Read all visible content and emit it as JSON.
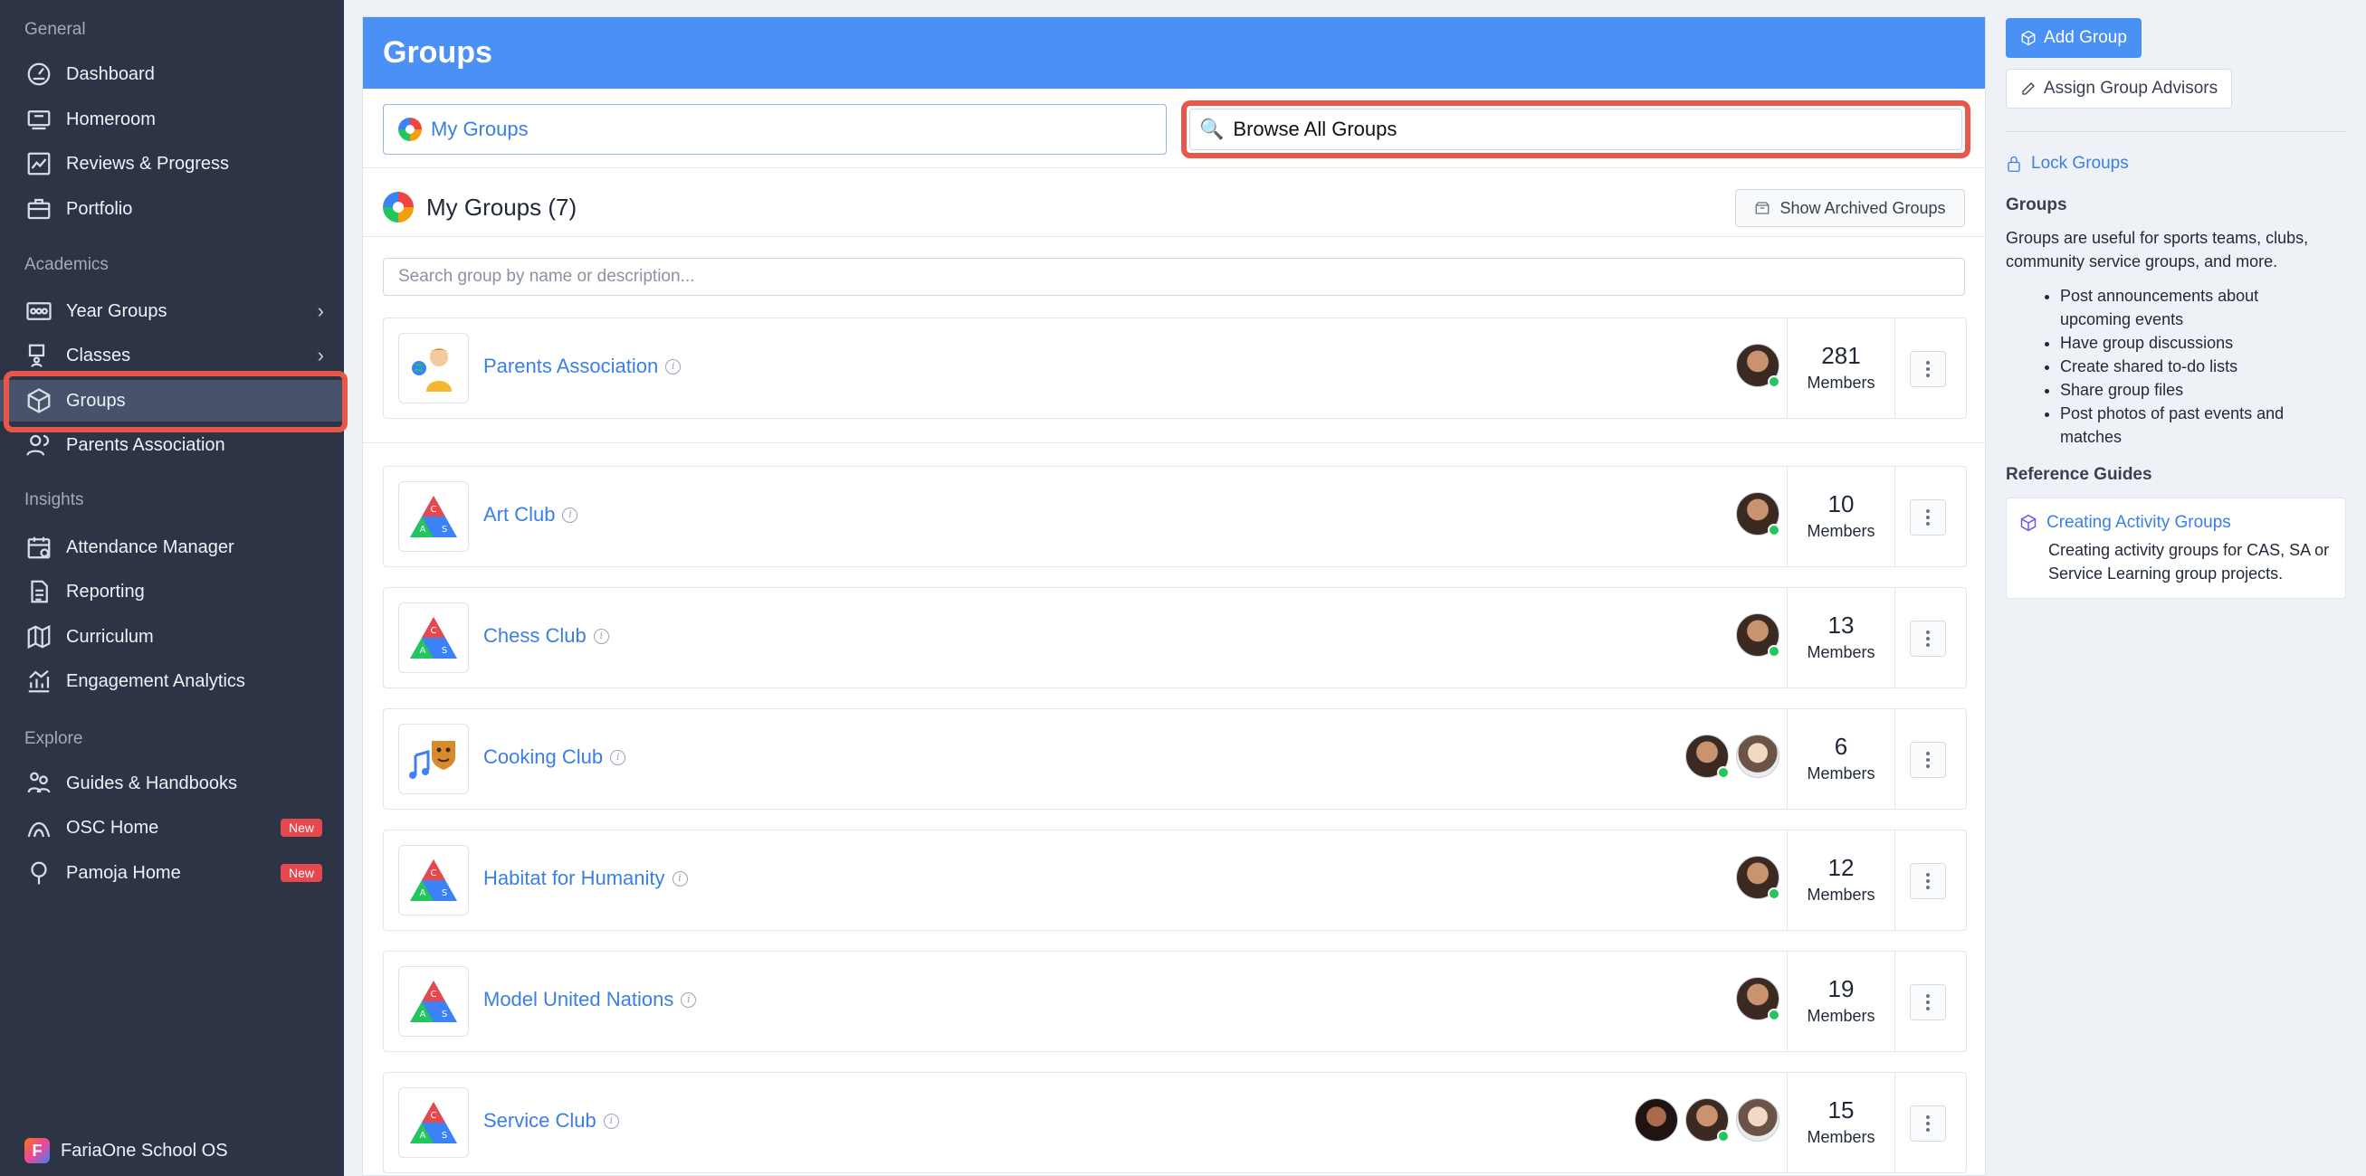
{
  "sidebar": {
    "sections": [
      "General",
      "Academics",
      "Insights",
      "Explore"
    ],
    "general": [
      {
        "label": "Dashboard",
        "icon": "dashboard-icon"
      },
      {
        "label": "Homeroom",
        "icon": "homeroom-icon"
      },
      {
        "label": "Reviews & Progress",
        "icon": "chart-line-icon"
      },
      {
        "label": "Portfolio",
        "icon": "briefcase-icon"
      }
    ],
    "academics": [
      {
        "label": "Year Groups",
        "icon": "year-groups-icon"
      },
      {
        "label": "Classes",
        "icon": "classes-icon"
      },
      {
        "label": "Groups",
        "icon": "cube-icon"
      },
      {
        "label": "Parents Association",
        "icon": "parents-icon"
      }
    ],
    "insights": [
      {
        "label": "Attendance Manager",
        "icon": "calendar-icon"
      },
      {
        "label": "Reporting",
        "icon": "report-icon"
      },
      {
        "label": "Curriculum",
        "icon": "map-icon"
      },
      {
        "label": "Engagement Analytics",
        "icon": "analytics-icon"
      }
    ],
    "explore": [
      {
        "label": "Guides & Handbooks",
        "icon": "guides-icon"
      },
      {
        "label": "OSC Home",
        "icon": "osc-icon",
        "badge": "New"
      },
      {
        "label": "Pamoja Home",
        "icon": "pamoja-icon",
        "badge": "New"
      }
    ],
    "footer": "FariaOne School OS"
  },
  "main": {
    "title": "Groups",
    "tab_my_groups": "My Groups",
    "tab_browse": "Browse All Groups",
    "list_title": "My Groups (7)",
    "archived_button": "Show Archived Groups",
    "search_placeholder": "Search group by name or description...",
    "groups": [
      {
        "name": "Parents Association",
        "members": "281",
        "members_label": "Members"
      },
      {
        "name": "Art Club",
        "members": "10",
        "members_label": "Members"
      },
      {
        "name": "Chess Club",
        "members": "13",
        "members_label": "Members"
      },
      {
        "name": "Cooking Club",
        "members": "6",
        "members_label": "Members"
      },
      {
        "name": "Habitat for Humanity",
        "members": "12",
        "members_label": "Members"
      },
      {
        "name": "Model United Nations",
        "members": "19",
        "members_label": "Members"
      },
      {
        "name": "Service Club",
        "members": "15",
        "members_label": "Members"
      }
    ]
  },
  "right": {
    "add_group": "Add Group",
    "assign_advisors": "Assign Group Advisors",
    "lock_groups": "Lock Groups",
    "groups_heading": "Groups",
    "groups_desc": "Groups are useful for sports teams, clubs, community service groups, and more.",
    "bullets": [
      "Post announcements about upcoming events",
      "Have group discussions",
      "Create shared to-do lists",
      "Share group files",
      "Post photos of past events and matches"
    ],
    "ref_heading": "Reference Guides",
    "ref_link": "Creating Activity Groups",
    "ref_desc": "Creating activity groups for CAS, SA or Service Learning group projects."
  },
  "colors": {
    "sidebar_bg": "#2c3446",
    "accent_blue": "#4b90f5",
    "highlight_red": "#e8574b",
    "badge_red": "#e5484d",
    "online_green": "#22c55e"
  }
}
